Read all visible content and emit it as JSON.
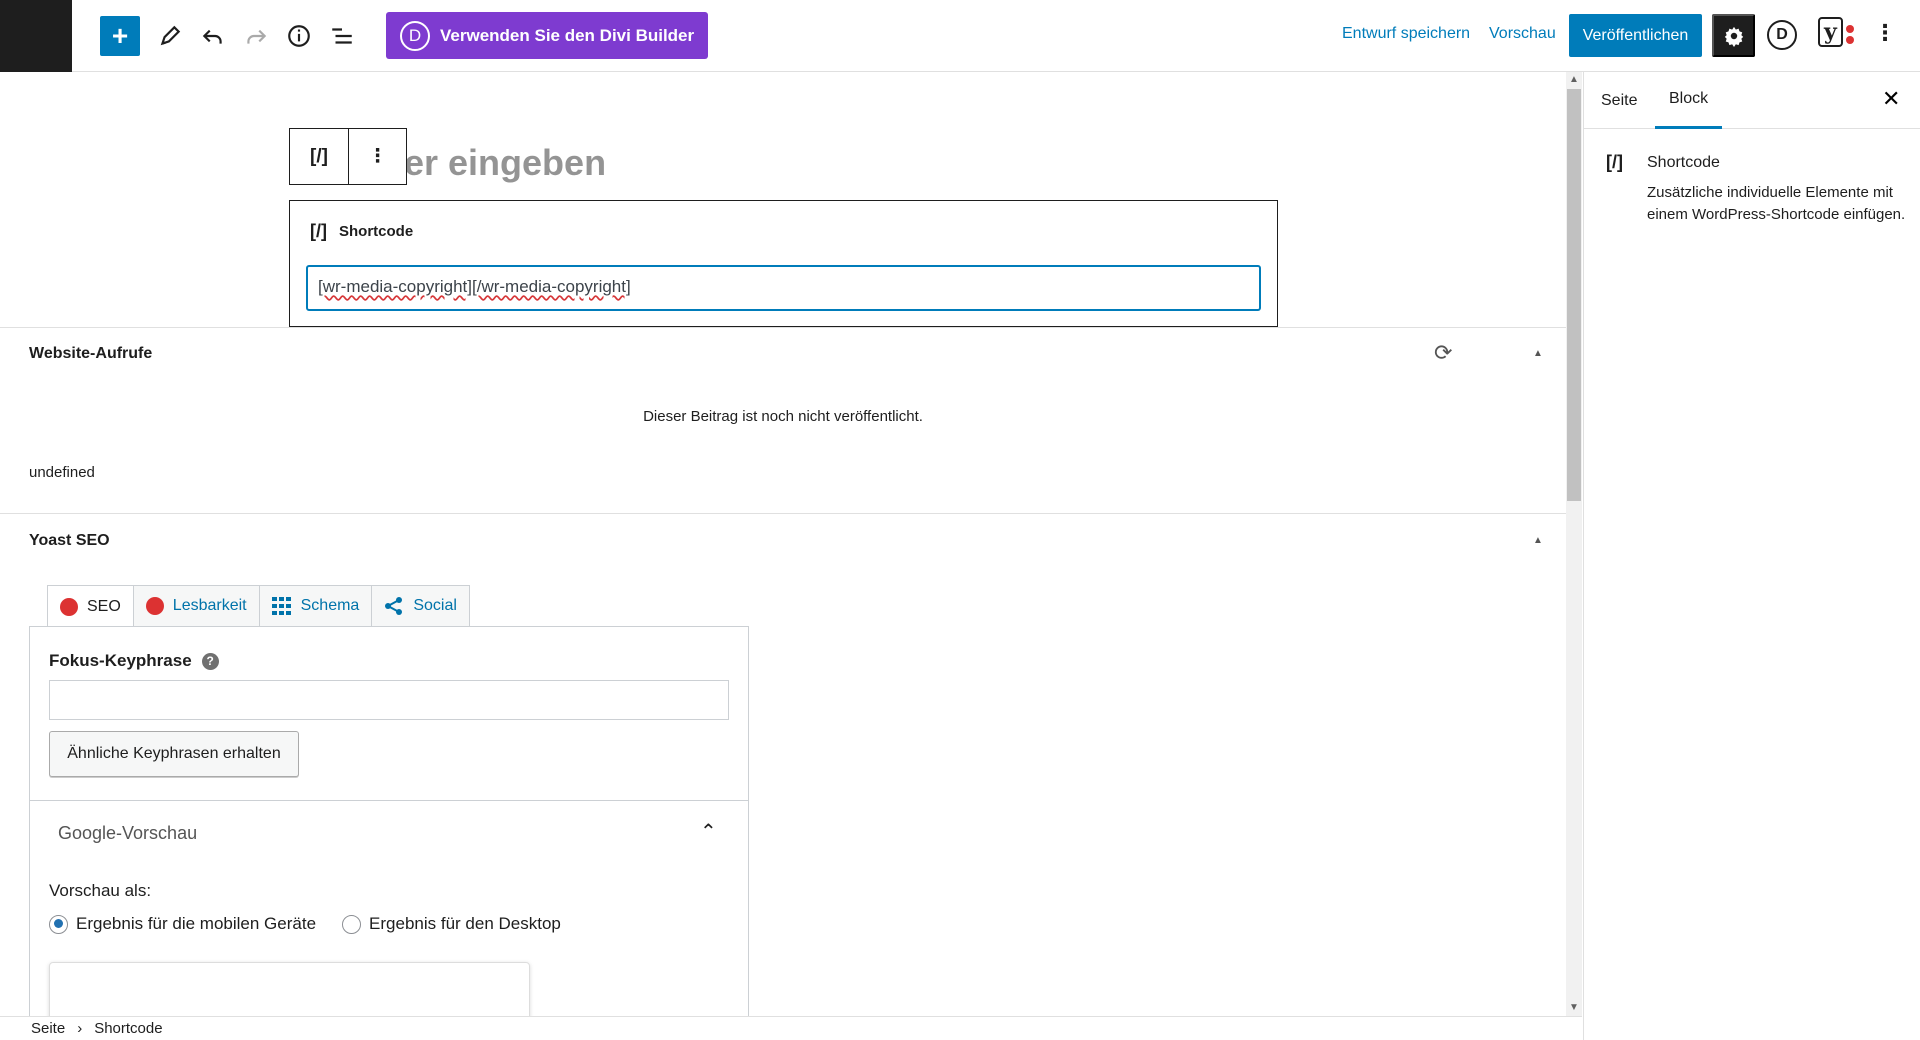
{
  "toolbar": {
    "add_symbol": "+",
    "divi_letter": "D",
    "divi_builder_label": "Verwenden Sie den Divi Builder",
    "save_draft": "Entwurf speichern",
    "preview": "Vorschau",
    "publish": "Veröffentlichen",
    "divi_icon_letter": "D",
    "yoast_letter": "y",
    "more": "⋮"
  },
  "editor": {
    "title_placeholder_visible": "er eingeben",
    "block_toolbar_icon": "[/]",
    "block_toolbar_more": "⋮",
    "shortcode_block": {
      "icon": "[/]",
      "label": "Shortcode",
      "value_part1": "[wr-media-copyright]",
      "value_part2": "[/wr-media-copyright]"
    }
  },
  "panels": {
    "website_views": {
      "title": "Website-Aufrufe",
      "message": "Dieser Beitrag ist noch nicht veröffentlicht.",
      "extra": "undefined"
    },
    "yoast": {
      "title": "Yoast SEO",
      "tabs": [
        {
          "label": "SEO",
          "status": "red"
        },
        {
          "label": "Lesbarkeit",
          "status": "red"
        },
        {
          "label": "Schema",
          "icon": "grid-icon"
        },
        {
          "label": "Social",
          "icon": "share-icon"
        }
      ],
      "focus_keyphrase_label": "Fokus-Keyphrase",
      "focus_keyphrase_value": "",
      "related_keyphrases_button": "Ähnliche Keyphrasen erhalten",
      "google_preview_title": "Google-Vorschau",
      "preview_as_label": "Vorschau als:",
      "radio_mobile": "Ergebnis für die mobilen Geräte",
      "radio_desktop": "Ergebnis für den Desktop",
      "selected": "mobile"
    }
  },
  "sidebar": {
    "tabs": [
      "Seite",
      "Block"
    ],
    "active_tab": "Block",
    "close": "✕",
    "block_icon": "[/]",
    "block_name": "Shortcode",
    "block_description": "Zusätzliche individuelle Elemente mit einem WordPress-Shortcode einfügen."
  },
  "breadcrumb": {
    "root": "Seite",
    "separator": "›",
    "current": "Shortcode"
  },
  "colors": {
    "accent": "#007cba",
    "divi_purple": "#7e3bd0",
    "yoast_red": "#dc3232"
  }
}
